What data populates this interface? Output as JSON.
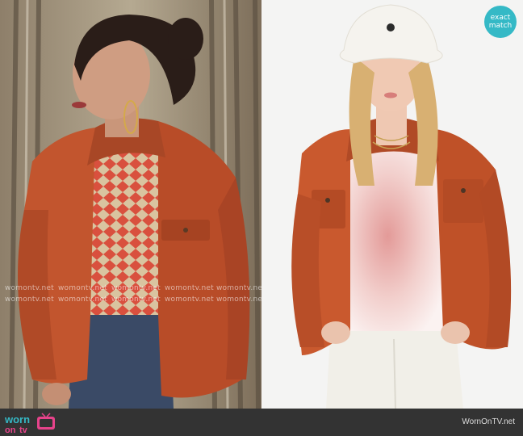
{
  "badge": {
    "line1": "exact",
    "line2": "match",
    "color": "#35b9c6"
  },
  "watermark": {
    "text": "womontv.net"
  },
  "footer": {
    "logo_word1": "worn",
    "logo_word2": "on",
    "logo_word3": "tv",
    "site": "WornOnTV.net",
    "background": "#333333"
  },
  "colors": {
    "jacket": "#c2552e",
    "top_left_pattern": "#d9503e",
    "jeans": "#3a4a66",
    "tee_tie_dye": "#e8a7a5",
    "pants_white": "#f1efe8",
    "hat": "#f5f3ee"
  },
  "icons": [
    "tv-icon"
  ]
}
